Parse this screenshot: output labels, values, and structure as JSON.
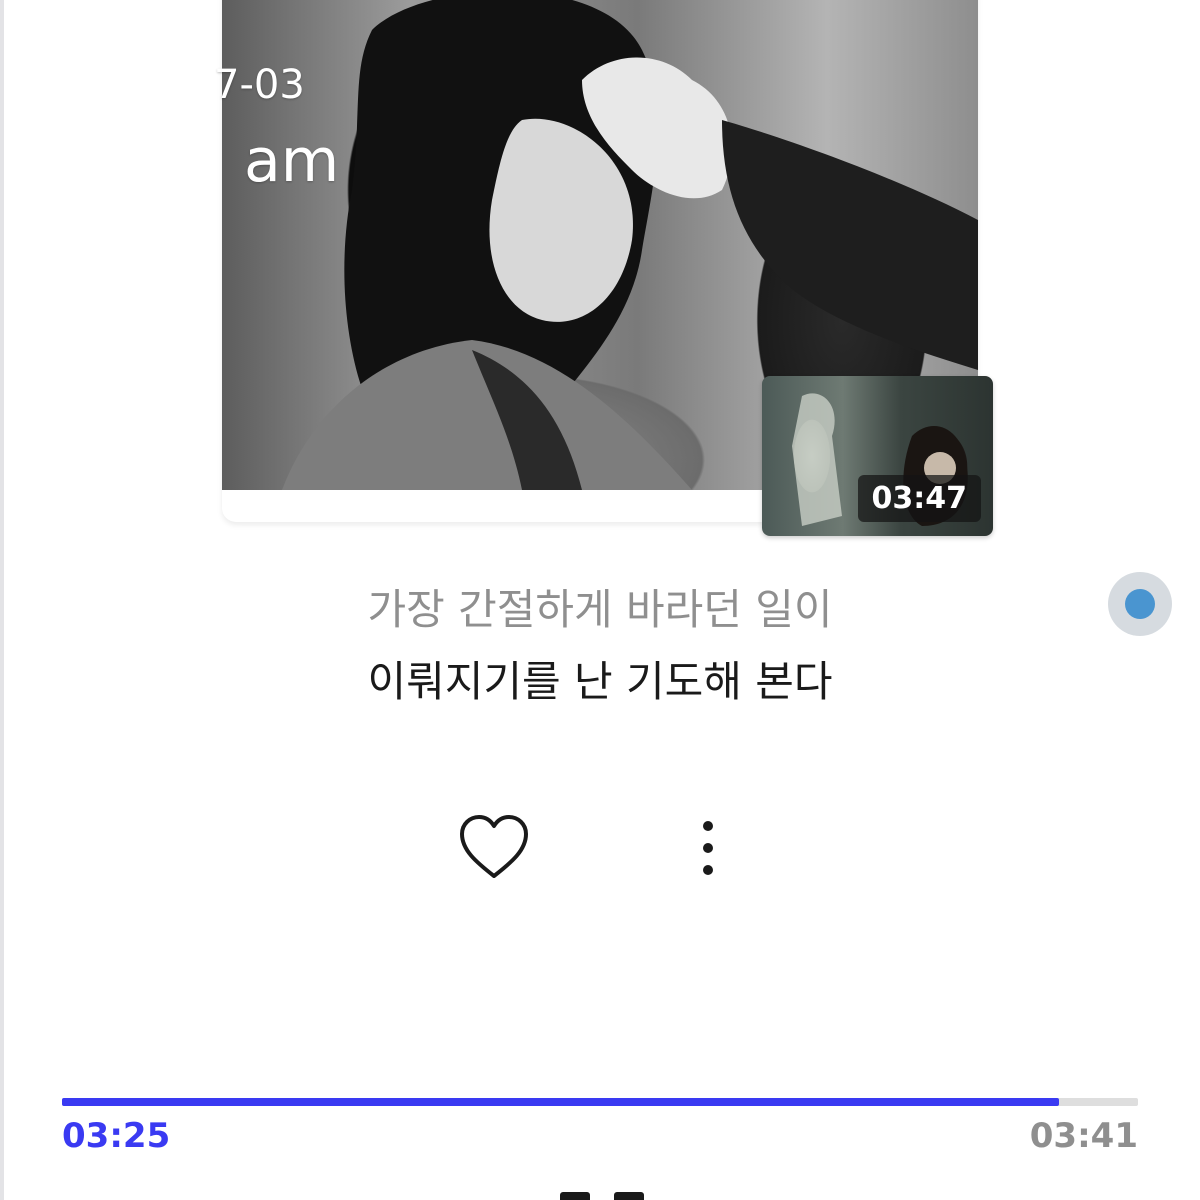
{
  "overlay": {
    "date": "7-03",
    "time": "am"
  },
  "video": {
    "duration": "03:47"
  },
  "lyrics": {
    "previous": "가장 간절하게 바라던 일이",
    "current": "이뤄지기를 난 기도해 본다"
  },
  "actions": {
    "like_icon": "heart-icon",
    "more_icon": "more-vertical-icon"
  },
  "playback": {
    "elapsed": "03:25",
    "total": "03:41",
    "progress_fraction": 0.927,
    "accent_color": "#3a3af2"
  }
}
